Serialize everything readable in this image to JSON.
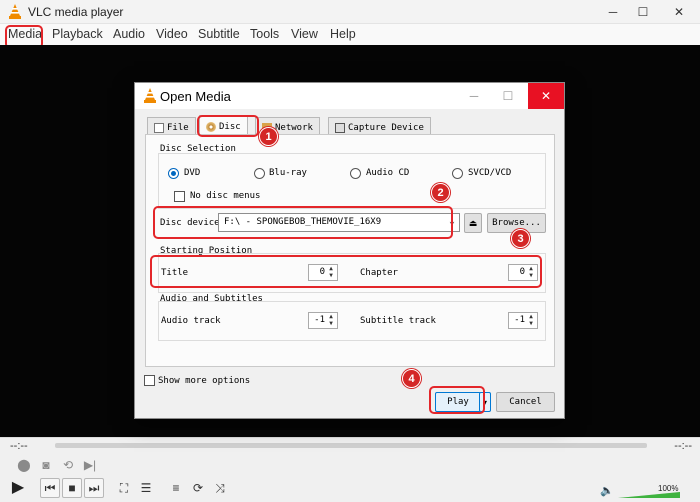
{
  "window": {
    "title": "VLC media player"
  },
  "menu": [
    "Media",
    "Playback",
    "Audio",
    "Video",
    "Subtitle",
    "Tools",
    "View",
    "Help"
  ],
  "controls": {
    "elapsed": "--:--",
    "remaining": "--:--",
    "volume": "100%",
    "volume_level": 1.0
  },
  "dialog": {
    "title": "Open Media",
    "tabs": [
      "File",
      "Disc",
      "Network",
      "Capture Device"
    ],
    "disc_selection": {
      "title": "Disc Selection",
      "options": [
        "DVD",
        "Blu-ray",
        "Audio CD",
        "SVCD/VCD"
      ],
      "selected": "DVD",
      "no_disc_menus": "No disc menus",
      "disc_device_label": "Disc device",
      "disc_device_value": "F:\\ - SPONGEBOB_THEMOVIE_16X9",
      "browse": "Browse..."
    },
    "starting_position": {
      "title": "Starting Position",
      "title_label": "Title",
      "title_value": "0",
      "chapter_label": "Chapter",
      "chapter_value": "0"
    },
    "audio_subtitles": {
      "title": "Audio and Subtitles",
      "audio_label": "Audio track",
      "audio_value": "-1",
      "subtitle_label": "Subtitle track",
      "subtitle_value": "-1"
    },
    "show_more": "Show more options",
    "play": "Play",
    "cancel": "Cancel"
  },
  "annotations": {
    "step1": "1",
    "step2": "2",
    "step3": "3",
    "step4": "4",
    "color": "#e3262a"
  }
}
